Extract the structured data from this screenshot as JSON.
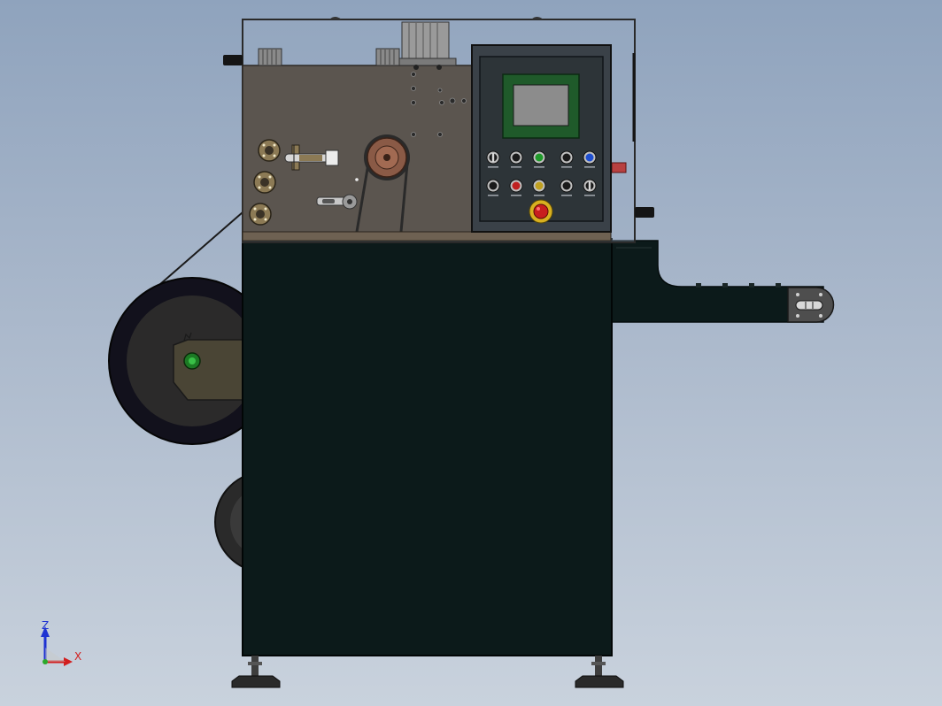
{
  "colors": {
    "background_top": "#8fa3bd",
    "background_bottom": "#c9d2dd",
    "cabinet": "#0c1a1a",
    "plate": "#5b554f",
    "shelf": "#6e6152",
    "guard": "#3a3a3a",
    "panel": "#2d3438",
    "screen_frame": "#1f5a2a",
    "screen": "#8c8c8c",
    "sprocket": "#8a5a46",
    "reel": "#12111c",
    "arm": "#4a4535",
    "brass": "#8c7a55",
    "indicator_green": "#1f9a2a",
    "indicator_red": "#c02020",
    "indicator_yellow": "#c0a020",
    "indicator_blue": "#1f4fd0",
    "estop": "#c81e1e",
    "estop_ring": "#d8b020",
    "axis_x": "#d21e1e",
    "axis_z": "#1e32d2"
  },
  "control_panel": {
    "buttons_row1": [
      {
        "icon": "selector-switch-icon",
        "color": "#1a1a1a"
      },
      {
        "icon": "pushbutton-icon",
        "color": "#1a1a1a"
      },
      {
        "icon": "pushbutton-icon",
        "color": "#1f9a2a"
      },
      {
        "icon": "pushbutton-icon",
        "color": "#1a1a1a"
      },
      {
        "icon": "pushbutton-icon",
        "color": "#1f4fd0"
      }
    ],
    "buttons_row2": [
      {
        "icon": "pushbutton-icon",
        "color": "#1a1a1a"
      },
      {
        "icon": "pushbutton-icon",
        "color": "#c02020"
      },
      {
        "icon": "pushbutton-icon",
        "color": "#c0a020"
      },
      {
        "icon": "pushbutton-icon",
        "color": "#1a1a1a"
      },
      {
        "icon": "selector-switch-icon",
        "color": "#1a1a1a"
      }
    ],
    "estop_icon": "emergency-stop-icon"
  },
  "triad": {
    "x_label": "X",
    "z_label": "Z"
  }
}
